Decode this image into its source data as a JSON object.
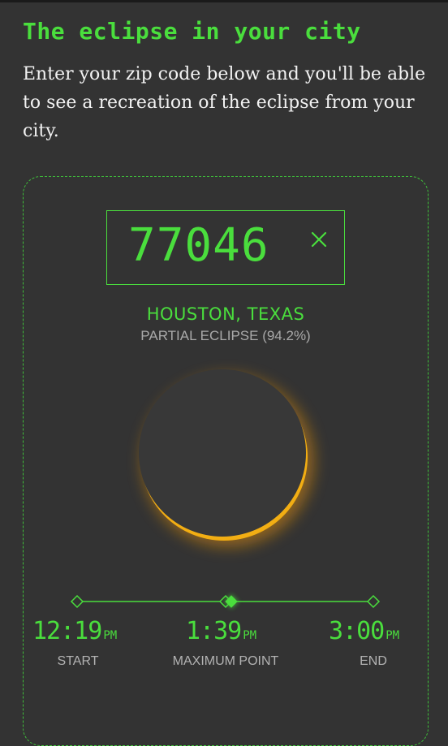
{
  "heading": "The eclipse in your city",
  "intro": "Enter your zip code below and you'll be able to see a recreation of the eclipse from your city.",
  "zip": {
    "value": "77046"
  },
  "location": "HOUSTON, TEXAS",
  "eclipse_type": "PARTIAL ECLIPSE (94.2%)",
  "coverage": 0.942,
  "colors": {
    "accent": "#4ade3d",
    "background": "#333333",
    "sun": "#f5b818",
    "moon": "#383838"
  },
  "times": {
    "start": {
      "value": "12:19",
      "ampm": "PM",
      "label": "START"
    },
    "max": {
      "value": "1:39",
      "ampm": "PM",
      "label": "MAXIMUM POINT"
    },
    "end": {
      "value": "3:00",
      "ampm": "PM",
      "label": "END"
    }
  },
  "icons": {
    "clear": "close-icon",
    "timeline_markers": "diamond-icon"
  }
}
